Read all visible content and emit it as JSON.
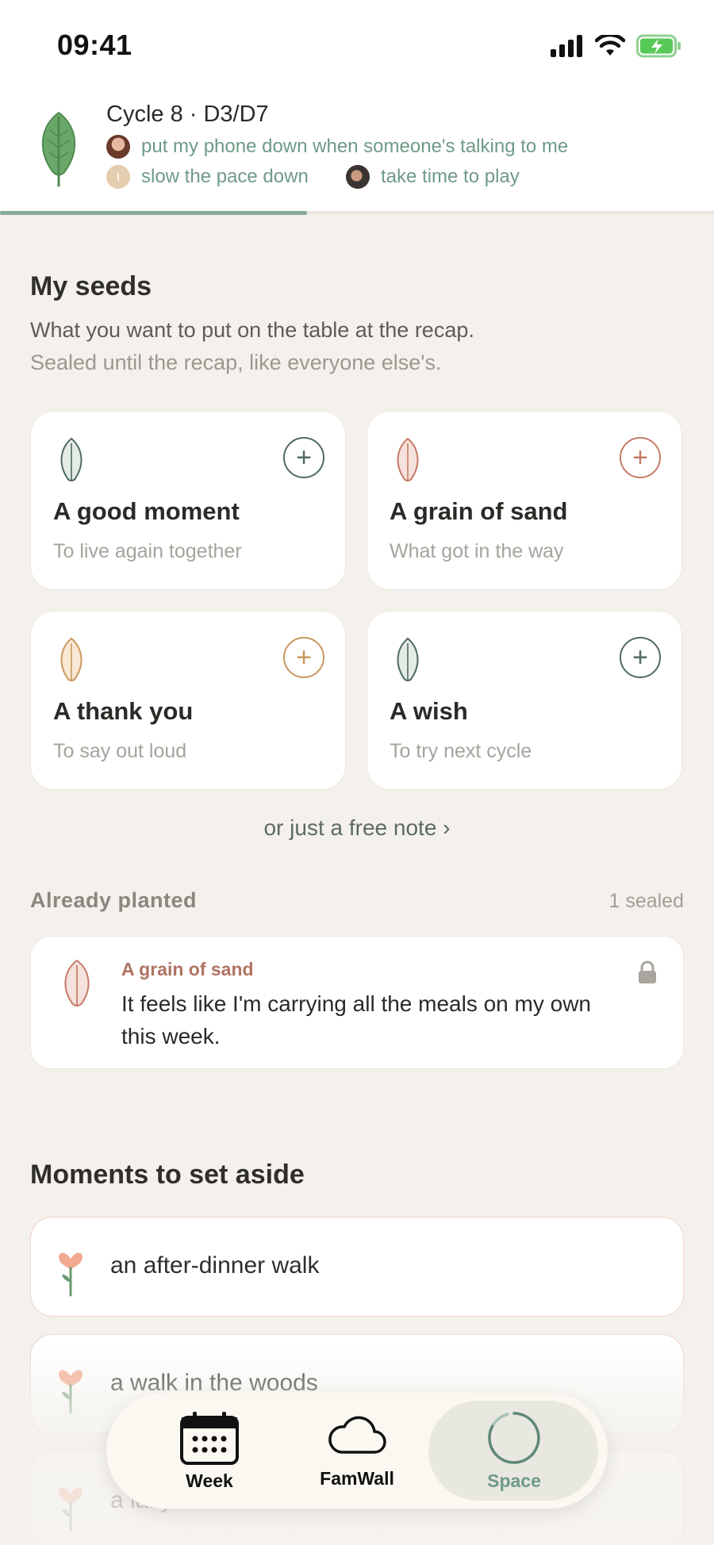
{
  "status": {
    "time": "09:41"
  },
  "header": {
    "cycle": "Cycle 8 · D3/D7",
    "intentions": [
      {
        "text": "put my phone down when someone's talking to me"
      },
      {
        "text": "slow the pace down",
        "avatar_initial": "I"
      },
      {
        "text": "take time to play"
      }
    ],
    "progress": 0.43
  },
  "seeds": {
    "title": "My seeds",
    "subtitle_1": "What you want to put on the table at the recap.",
    "subtitle_2": "Sealed until the recap, like everyone else's.",
    "cards": [
      {
        "title": "A good moment",
        "subtitle": "To live again together",
        "color": "#4f6b60",
        "leaf_fill": "#e4ece6"
      },
      {
        "title": "A grain of sand",
        "subtitle": "What got in the way",
        "color": "#c77b68",
        "leaf_fill": "#f6e2dc"
      },
      {
        "title": "A thank you",
        "subtitle": "To say out loud",
        "color": "#c9985e",
        "leaf_fill": "#f8e8d4"
      },
      {
        "title": "A wish",
        "subtitle": "To try next cycle",
        "color": "#4f6b60",
        "leaf_fill": "#e4ece6"
      }
    ],
    "free_note": "or just a free note ›"
  },
  "planted": {
    "label": "Already planted",
    "count": "1 sealed",
    "items": [
      {
        "kind": "A grain of sand",
        "text": "It feels like I'm carrying all the meals on my own this week."
      }
    ]
  },
  "moments": {
    "title": "Moments to set aside",
    "items": [
      {
        "label": "an after-dinner walk"
      },
      {
        "label": "a walk in the woods"
      },
      {
        "label": "a lazy breakfast"
      }
    ]
  },
  "tabbar": {
    "tabs": [
      {
        "label": "Week",
        "icon": "calendar-icon"
      },
      {
        "label": "FamWall",
        "icon": "cloud-icon"
      },
      {
        "label": "Space",
        "icon": "circle-icon",
        "active": true
      }
    ]
  },
  "colors": {
    "accent": "#6f9a86",
    "background": "#f4f1ec"
  }
}
